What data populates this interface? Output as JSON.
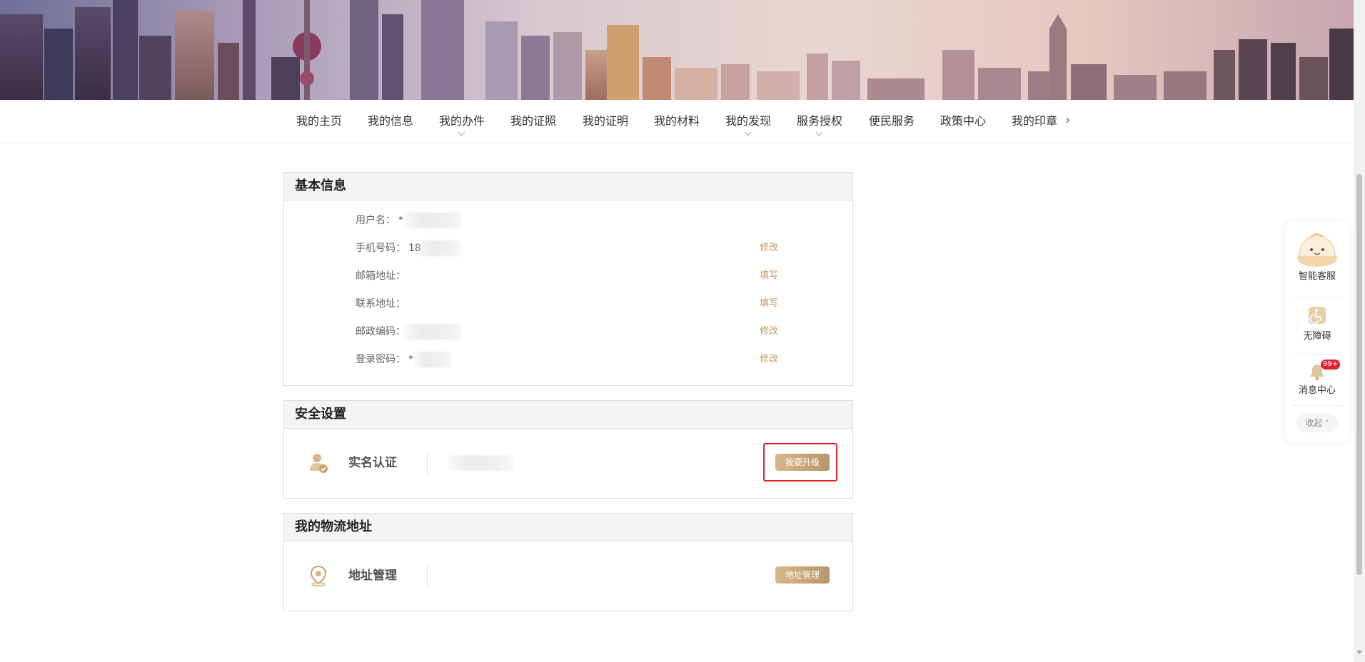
{
  "nav": {
    "items": [
      "我的主页",
      "我的信息",
      "我的办件",
      "我的证照",
      "我的证明",
      "我的材料",
      "我的发现",
      "服务授权",
      "便民服务",
      "政策中心",
      "我的印章"
    ],
    "next_icon": "chevron-right-icon"
  },
  "basic_info": {
    "title": "基本信息",
    "rows": [
      {
        "label": "用户名：",
        "value": "*",
        "action": ""
      },
      {
        "label": "手机号码：",
        "value": "18",
        "action": "修改"
      },
      {
        "label": "邮箱地址：",
        "value": "",
        "action": "填写"
      },
      {
        "label": "联系地址：",
        "value": "",
        "action": "填写"
      },
      {
        "label": "邮政编码：",
        "value": "",
        "action": "修改"
      },
      {
        "label": "登录密码：",
        "value": "*",
        "action": "修改"
      }
    ]
  },
  "security": {
    "title": "安全设置",
    "item_label": "实名认证",
    "button_label": "我要升级",
    "icon": "verified-user-icon"
  },
  "logistics": {
    "title": "我的物流地址",
    "item_label": "地址管理",
    "button_label": "地址管理",
    "icon": "location-pin-icon"
  },
  "float_panel": {
    "service_label": "智能客服",
    "accessibility_label": "无障碍",
    "message_label": "消息中心",
    "message_badge": "99+",
    "collapse_label": "收起"
  },
  "colors": {
    "accent": "#c49a5e",
    "highlight": "#e0232b",
    "badge": "#e0232b"
  }
}
